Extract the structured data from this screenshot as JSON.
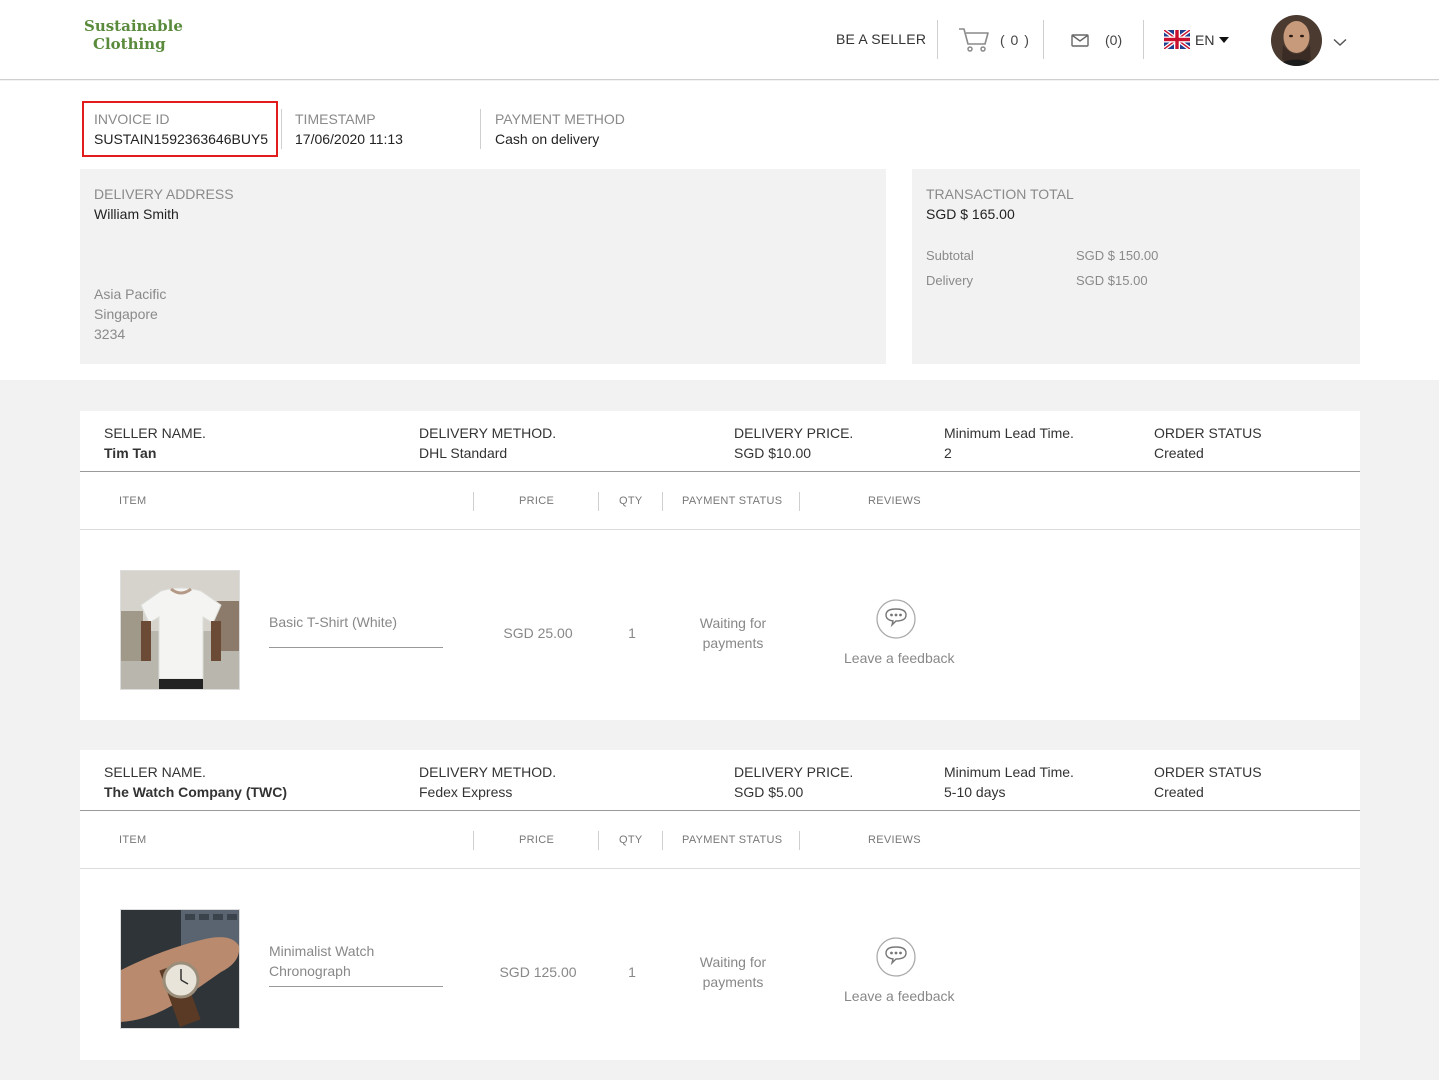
{
  "header": {
    "logo_line1": "Sustainable",
    "logo_line2": "Clothing",
    "be_seller": "BE A SELLER",
    "cart_count": "( 0 )",
    "mail_count": "(0)",
    "language": "EN"
  },
  "invoice": {
    "invoice_label": "INVOICE ID",
    "invoice_value": "SUSTAIN1592363646BUY5",
    "timestamp_label": "TIMESTAMP",
    "timestamp_value": "17/06/2020 11:13",
    "payment_label": "PAYMENT METHOD",
    "payment_value": "Cash on delivery"
  },
  "delivery_address": {
    "label": "DELIVERY ADDRESS",
    "name": "William Smith",
    "region": "Asia Pacific",
    "country": "Singapore",
    "postal": "3234"
  },
  "transaction": {
    "label": "TRANSACTION TOTAL",
    "total": "SGD $ 165.00",
    "subtotal_label": "Subtotal",
    "subtotal_value": "SGD $ 150.00",
    "delivery_label": "Delivery",
    "delivery_value": "SGD $15.00"
  },
  "columns": {
    "seller_name": "SELLER NAME.",
    "delivery_method": "DELIVERY METHOD.",
    "delivery_price": "DELIVERY PRICE.",
    "lead_time": "Minimum Lead Time.",
    "order_status": "ORDER STATUS",
    "item": "ITEM",
    "price": "PRICE",
    "qty": "QTY",
    "payment_status": "PAYMENT STATUS",
    "reviews": "REVIEWS"
  },
  "orders": [
    {
      "seller_name": "Tim Tan",
      "delivery_method": "DHL Standard",
      "delivery_price": "SGD $10.00",
      "lead_time": "2",
      "order_status": "Created",
      "item_name": "Basic T-Shirt (White)",
      "item_price": "SGD 25.00",
      "item_qty": "1",
      "payment_status_line1": "Waiting for",
      "payment_status_line2": "payments",
      "review_link": "Leave a feedback"
    },
    {
      "seller_name": "The Watch Company (TWC)",
      "delivery_method": "Fedex Express",
      "delivery_price": "SGD $5.00",
      "lead_time": "5-10 days",
      "order_status": "Created",
      "item_name": "Minimalist Watch Chronograph",
      "item_price": "SGD 125.00",
      "item_qty": "1",
      "payment_status_line1": "Waiting for",
      "payment_status_line2": "payments",
      "review_link": "Leave a feedback"
    }
  ],
  "colors": {
    "brand_green": "#5a8a3c",
    "highlight_red": "#e21c1c",
    "page_grey": "#f2f2f2"
  }
}
